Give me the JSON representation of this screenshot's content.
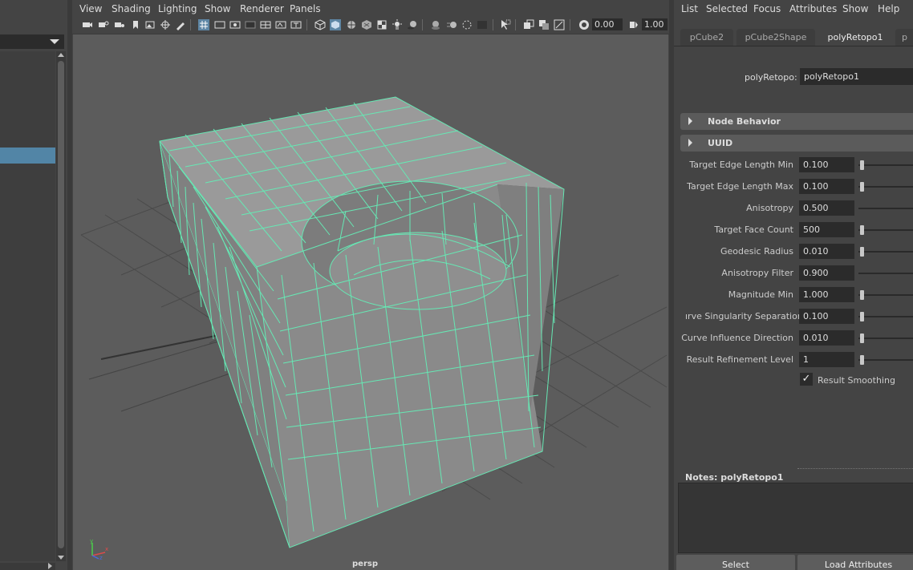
{
  "viewport": {
    "menu": [
      "View",
      "Shading",
      "Lighting",
      "Show",
      "Renderer",
      "Panels"
    ],
    "toolbar": {
      "field_a": "0.00",
      "field_b": "1.00"
    },
    "camera": "persp",
    "axis": {
      "x": "x",
      "y": "y",
      "z": "z"
    },
    "colors": {
      "wire": "#66e8b4",
      "mesh": "#8a8a8a",
      "canvas": "#5c5c5c"
    }
  },
  "attribute_editor": {
    "menu": [
      "List",
      "Selected",
      "Focus",
      "Attributes",
      "Show",
      "Help"
    ],
    "tabs": [
      "pCube2",
      "pCube2Shape",
      "polyRetopo1",
      "p"
    ],
    "active_tab": "polyRetopo1",
    "node_label": "polyRetopo:",
    "node_value": "polyRetopo1",
    "sections": [
      "Node Behavior",
      "UUID"
    ],
    "attributes": [
      {
        "label": "Target Edge Length Min",
        "value": "0.100",
        "slider": 0.02
      },
      {
        "label": "Target Edge Length Max",
        "value": "0.100",
        "slider": 0.02
      },
      {
        "label": "Anisotropy",
        "value": "0.500",
        "slider": null
      },
      {
        "label": "Target Face Count",
        "value": "500",
        "slider": 0.03
      },
      {
        "label": "Geodesic Radius",
        "value": "0.010",
        "slider": 0.02
      },
      {
        "label": "Anisotropy Filter",
        "value": "0.900",
        "slider": null
      },
      {
        "label": "Magnitude Min",
        "value": "1.000",
        "slider": 0.02
      },
      {
        "label": "ırve Singularity Separation",
        "value": "0.100",
        "slider": 0.02
      },
      {
        "label": "Curve Influence Direction",
        "value": "0.010",
        "slider": 0.02
      },
      {
        "label": "Result Refinement Level",
        "value": "1",
        "slider": 0.02
      }
    ],
    "result_smoothing": {
      "label": "Result Smoothing",
      "checked": true,
      "mark": "✓"
    },
    "notes_label": "Notes:  polyRetopo1",
    "buttons": {
      "select": "Select",
      "load": "Load Attributes"
    }
  }
}
